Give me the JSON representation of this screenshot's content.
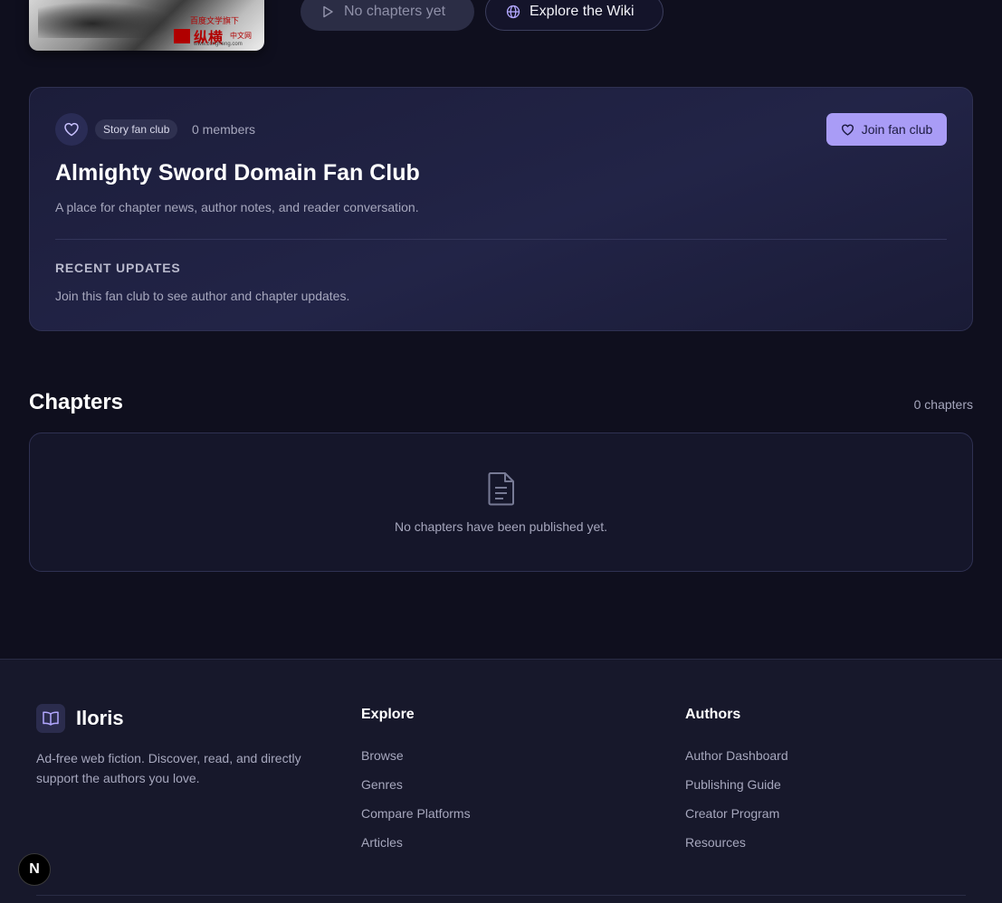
{
  "colors": {
    "page_bg": "#0f0f1e",
    "card_bg": "#1f2040",
    "accent": "#a99cf6",
    "footer_bg": "#17182b",
    "muted_text": "#a6a7bd"
  },
  "cover": {
    "stamp_top": "百度文学旗下",
    "stamp_main": "纵横",
    "stamp_sub": "中文网",
    "stamp_url": "www.zongheng.com"
  },
  "actions": {
    "start_reading_label": "No chapters yet",
    "start_reading_icon": "play-icon",
    "wiki_label": "Explore the Wiki",
    "wiki_icon": "globe-icon"
  },
  "fan_club": {
    "icon": "heart-icon",
    "badge": "Story fan club",
    "members": "0 members",
    "join_label": "Join fan club",
    "title": "Almighty Sword Domain Fan Club",
    "description": "A place for chapter news, author notes, and reader conversation.",
    "recent_heading": "RECENT UPDATES",
    "recent_text": "Join this fan club to see author and chapter updates."
  },
  "chapters": {
    "title": "Chapters",
    "count": "0 chapters",
    "empty_icon": "document-icon",
    "empty_text": "No chapters have been published yet."
  },
  "footer": {
    "logo_icon": "book-open-icon",
    "brand": "Iloris",
    "tagline": "Ad-free web fiction. Discover, read, and directly support the authors you love.",
    "explore": {
      "heading": "Explore",
      "links": [
        "Browse",
        "Genres",
        "Compare Platforms",
        "Articles"
      ]
    },
    "authors": {
      "heading": "Authors",
      "links": [
        "Author Dashboard",
        "Publishing Guide",
        "Creator Program",
        "Resources"
      ]
    }
  },
  "dev_badge": "N"
}
